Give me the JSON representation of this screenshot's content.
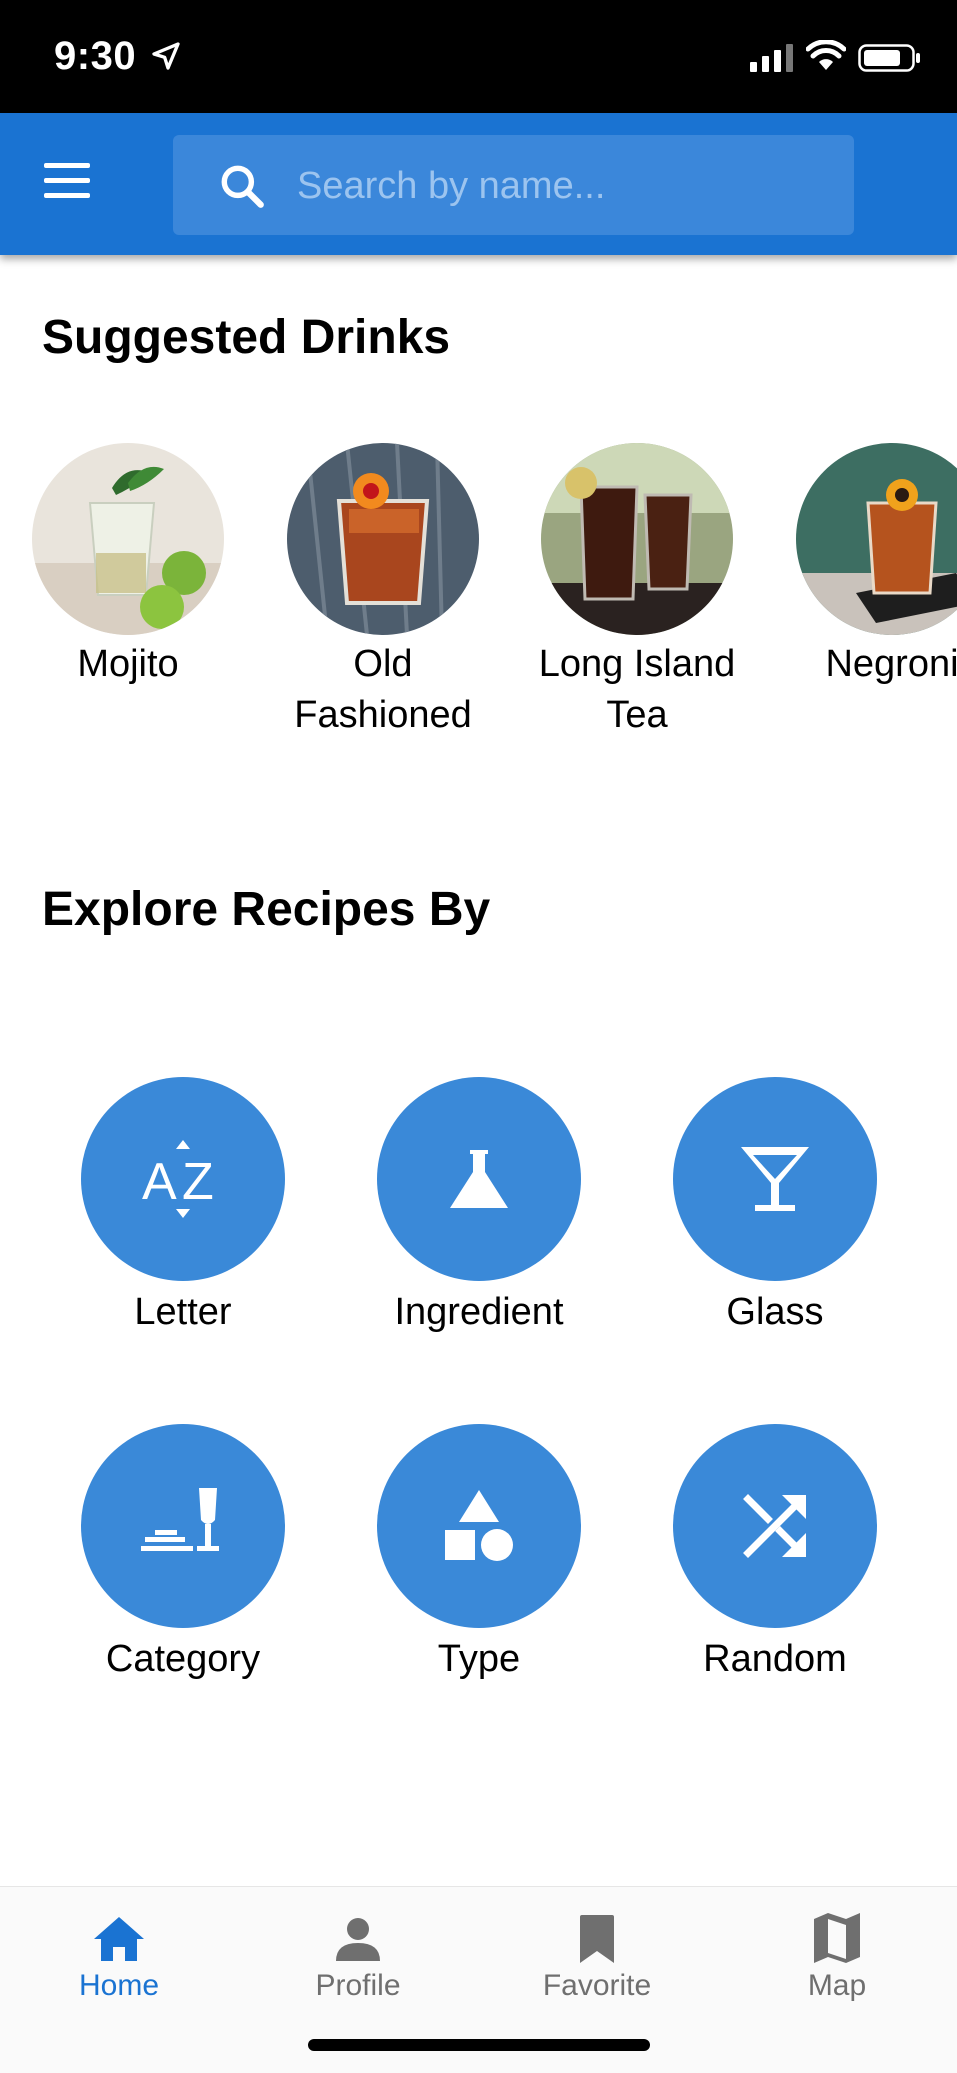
{
  "status_bar": {
    "time": "9:30"
  },
  "header": {
    "search_placeholder": "Search by name..."
  },
  "suggested": {
    "title": "Suggested Drinks",
    "drinks": [
      {
        "name": "Mojito"
      },
      {
        "name": "Old\nFashioned"
      },
      {
        "name": "Long Island\nTea"
      },
      {
        "name": "Negroni"
      }
    ]
  },
  "explore": {
    "title": "Explore Recipes By",
    "items": [
      {
        "label": "Letter",
        "icon": "sort-az-icon"
      },
      {
        "label": "Ingredient",
        "icon": "flask-icon"
      },
      {
        "label": "Glass",
        "icon": "cocktail-glass-icon"
      },
      {
        "label": "Category",
        "icon": "champagne-category-icon"
      },
      {
        "label": "Type",
        "icon": "shapes-icon"
      },
      {
        "label": "Random",
        "icon": "shuffle-icon"
      }
    ]
  },
  "bottom_nav": {
    "items": [
      {
        "label": "Home",
        "icon": "home-icon",
        "active": true
      },
      {
        "label": "Profile",
        "icon": "person-icon"
      },
      {
        "label": "Favorite",
        "icon": "bookmark-icon"
      },
      {
        "label": "Map",
        "icon": "map-icon"
      }
    ]
  },
  "colors": {
    "app_bar": "#1a73d2",
    "circle": "#3a89d8",
    "nav_active": "#1a73d2",
    "nav_inactive": "#6f6f6f"
  }
}
